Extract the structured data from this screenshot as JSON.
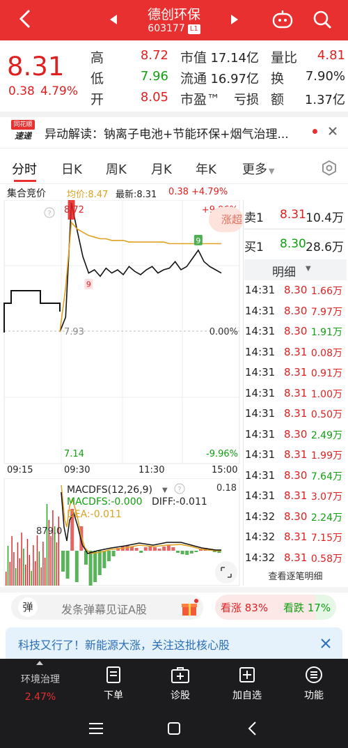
{
  "header": {
    "title": "德创环保",
    "code": "603177",
    "board_tag": "L1"
  },
  "quote": {
    "price": "8.31",
    "change": "0.38",
    "change_pct": "4.79%",
    "rows": [
      {
        "l1": "高",
        "v1": "8.72",
        "l2": "市值",
        "v2": "17.14亿",
        "l3": "量比",
        "v3": "4.81"
      },
      {
        "l1": "低",
        "v1": "7.96",
        "l2": "流通",
        "v2": "16.97亿",
        "l3": "换",
        "v3": "7.90%"
      },
      {
        "l1": "开",
        "v1": "8.05",
        "l2": "市盈™",
        "v2": "亏损",
        "l3": "额",
        "v3": "1.37亿"
      }
    ]
  },
  "news": {
    "logo_top": "同花顺",
    "logo_bottom": "速递",
    "text": "异动解读：钠离子电池+节能环保+烟气治理..."
  },
  "tabs": [
    "分时",
    "日K",
    "周K",
    "月K",
    "年K",
    "更多"
  ],
  "chart_header": {
    "label": "集合竞价",
    "avg": "均价:8.47",
    "latest": "最新:8.31",
    "chg": "0.38",
    "chg_pct": "+4.79%"
  },
  "chart_data": {
    "type": "line",
    "title": "",
    "y_top_label": "8.72",
    "y_mid_label": "7.93",
    "y_bottom_label": "7.14",
    "pct_top": "+9.96%",
    "pct_mid": "0.00%",
    "pct_bottom": "-9.96%",
    "x_labels": [
      "09:15",
      "09:30",
      "11:30",
      "15:00"
    ],
    "ylim": [
      7.14,
      8.72
    ],
    "series": [
      {
        "values": [
          7.93,
          8.02,
          8.72,
          8.55,
          8.39,
          8.29,
          8.31,
          8.27,
          8.32,
          8.29,
          8.31,
          8.28,
          8.33,
          8.3,
          8.28,
          8.31,
          8.33,
          8.29,
          8.31,
          8.32,
          8.36,
          8.31,
          8.33,
          8.38,
          8.43,
          8.36,
          8.33,
          8.31,
          8.29
        ]
      },
      {
        "values": [
          7.93,
          8.2,
          8.6,
          8.56,
          8.54,
          8.52,
          8.51,
          8.5,
          8.5,
          8.49,
          8.49,
          8.49,
          8.48,
          8.48,
          8.48,
          8.48,
          8.48,
          8.48,
          8.48,
          8.47,
          8.47,
          8.47,
          8.47,
          8.47,
          8.47,
          8.47,
          8.47,
          8.47,
          8.47
        ]
      }
    ],
    "marker_low": "9",
    "marker_high": "9",
    "badge": "涨超"
  },
  "macd": {
    "title": "MACDFS(12,26,9)",
    "macdfs": "MACDFS:-0.000",
    "diff": "DIFF:-0.011",
    "dea": "DEA:-0.011",
    "top_value": "0.18",
    "vol_label": "879.0"
  },
  "orderbook": {
    "sell_label": "卖1",
    "sell_price": "8.31",
    "sell_vol": "10.4万",
    "buy_label": "买1",
    "buy_price": "8.30",
    "buy_vol": "28.6万",
    "detail_label": "明细",
    "trades": [
      {
        "t": "14:31",
        "p": "8.30",
        "v": "1.66万",
        "c": "red"
      },
      {
        "t": "14:31",
        "p": "8.30",
        "v": "7.97万",
        "c": "red"
      },
      {
        "t": "14:31",
        "p": "8.30",
        "v": "1.91万",
        "c": "green"
      },
      {
        "t": "14:31",
        "p": "8.31",
        "v": "0.08万",
        "c": "red"
      },
      {
        "t": "14:31",
        "p": "8.31",
        "v": "0.91万",
        "c": "red"
      },
      {
        "t": "14:31",
        "p": "8.31",
        "v": "1.00万",
        "c": "red"
      },
      {
        "t": "14:31",
        "p": "8.31",
        "v": "0.50万",
        "c": "red"
      },
      {
        "t": "14:31",
        "p": "8.30",
        "v": "2.49万",
        "c": "green"
      },
      {
        "t": "14:31",
        "p": "8.31",
        "v": "1.99万",
        "c": "red"
      },
      {
        "t": "14:31",
        "p": "8.30",
        "v": "7.64万",
        "c": "green"
      },
      {
        "t": "14:31",
        "p": "8.31",
        "v": "3.07万",
        "c": "red"
      },
      {
        "t": "14:32",
        "p": "8.30",
        "v": "2.24万",
        "c": "green"
      },
      {
        "t": "14:32",
        "p": "8.31",
        "v": "7.15万",
        "c": "red"
      },
      {
        "t": "14:32",
        "p": "8.31",
        "v": "0.58万",
        "c": "red"
      }
    ],
    "view_more": "查看逐笔明细"
  },
  "danmu": {
    "icon_label": "弹",
    "placeholder": "发条弹幕见证A股",
    "up_label": "看涨 83%",
    "down_label": "看跌 17%",
    "up_ratio": 0.83
  },
  "banner": {
    "text": "科技又行了！新能源大涨，关注这批核心股"
  },
  "bottom_nav": {
    "sector_name": "环境治理",
    "sector_chg": "2.47%",
    "items": [
      "下单",
      "诊股",
      "加自选",
      "功能"
    ]
  },
  "colors": {
    "header_bg": "#e93030",
    "up": "#e02020",
    "down": "#10a010",
    "avg_line": "#e0a020",
    "nav_bg": "#1c1c1e"
  }
}
